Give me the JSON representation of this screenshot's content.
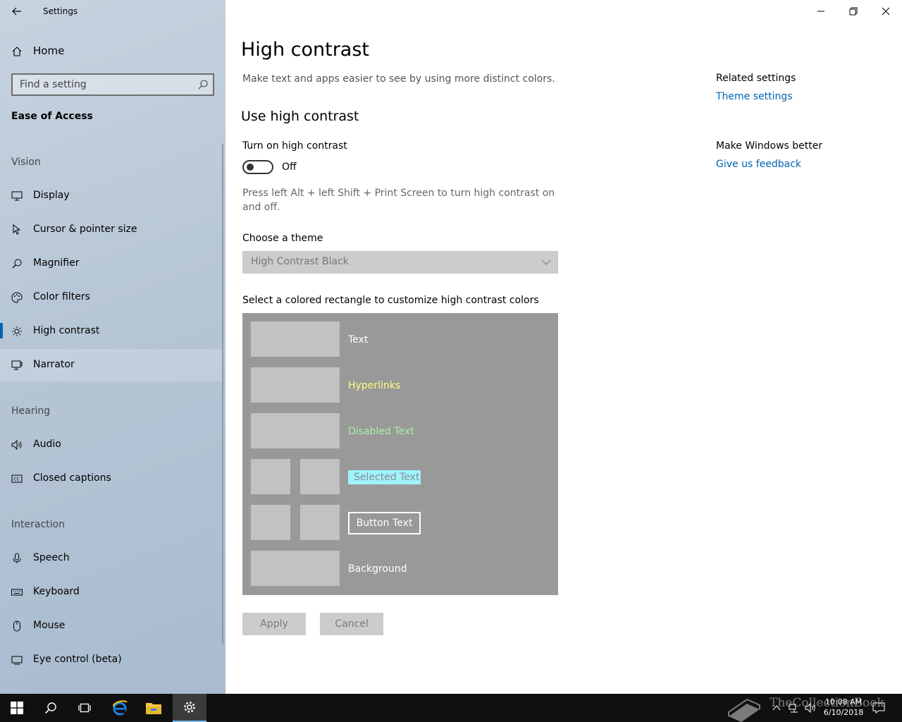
{
  "app": {
    "title": "Settings"
  },
  "sidebar": {
    "home_label": "Home",
    "search_placeholder": "Find a setting",
    "section_title": "Ease of Access",
    "groups": {
      "vision": "Vision",
      "hearing": "Hearing",
      "interaction": "Interaction"
    },
    "items": [
      {
        "label": "Display",
        "icon": "display-icon"
      },
      {
        "label": "Cursor & pointer size",
        "icon": "cursor-icon"
      },
      {
        "label": "Magnifier",
        "icon": "magnifier-icon"
      },
      {
        "label": "Color filters",
        "icon": "palette-icon"
      },
      {
        "label": "High contrast",
        "icon": "sun-icon",
        "selected": true
      },
      {
        "label": "Narrator",
        "icon": "narrator-icon"
      },
      {
        "label": "Audio",
        "icon": "speaker-icon"
      },
      {
        "label": "Closed captions",
        "icon": "cc-icon"
      },
      {
        "label": "Speech",
        "icon": "microphone-icon"
      },
      {
        "label": "Keyboard",
        "icon": "keyboard-icon"
      },
      {
        "label": "Mouse",
        "icon": "mouse-icon"
      },
      {
        "label": "Eye control (beta)",
        "icon": "eye-icon"
      }
    ]
  },
  "main": {
    "title": "High contrast",
    "description": "Make text and apps easier to see by using more distinct colors.",
    "use_heading": "Use high contrast",
    "toggle_label": "Turn on high contrast",
    "toggle_state": "Off",
    "toggle_on": false,
    "hint": "Press left Alt + left Shift + Print Screen to turn high contrast on and off.",
    "theme_label": "Choose a theme",
    "theme_value": "High Contrast Black",
    "palette_label": "Select a colored rectangle to customize high contrast colors",
    "palette": {
      "text": "Text",
      "hyperlinks": "Hyperlinks",
      "disabled_text": "Disabled Text",
      "selected_text": "Selected Text",
      "button_text": "Button Text",
      "background": "Background"
    },
    "apply_label": "Apply",
    "cancel_label": "Cancel"
  },
  "right": {
    "related_heading": "Related settings",
    "theme_link": "Theme settings",
    "better_heading": "Make Windows better",
    "feedback_link": "Give us feedback"
  },
  "taskbar": {
    "time": "10:08 AM",
    "date": "6/10/2018",
    "watermark": "TheCollectionBook"
  },
  "colors": {
    "accent": "#0063b1",
    "palette_bg": "#999999",
    "hyperlink": "#ffff80",
    "disabled": "#a5f0a5",
    "selected_bg": "#9ff3ff"
  }
}
